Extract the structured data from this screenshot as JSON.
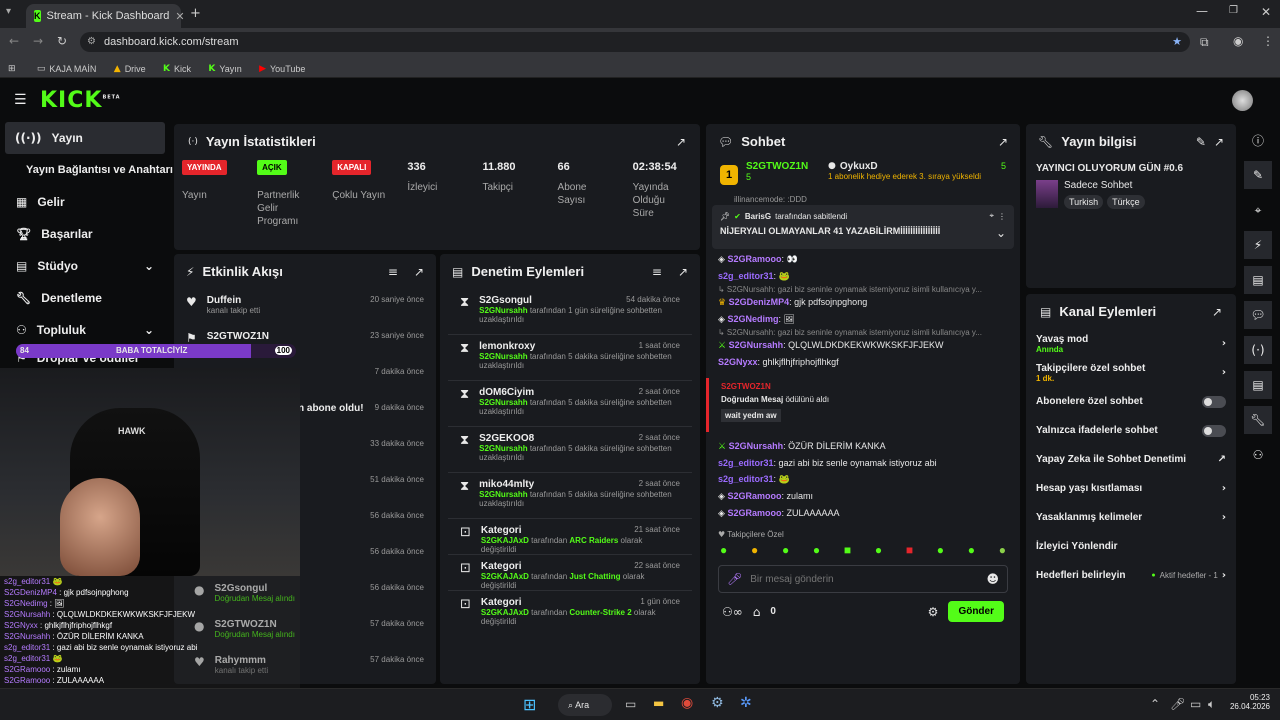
{
  "browser": {
    "tab_title": "Stream - Kick Dashboard",
    "url": "dashboard.kick.com/stream",
    "bookmarks": [
      {
        "label": "KAJA MAİN"
      },
      {
        "label": "Drive"
      },
      {
        "label": "Kick"
      },
      {
        "label": "Yayın"
      },
      {
        "label": "YouTube"
      }
    ]
  },
  "header": {
    "logo": "KICK",
    "logo_sup": "BETA"
  },
  "sidebar": {
    "items": [
      {
        "label": "Yayın"
      },
      {
        "label": "Yayın Bağlantısı ve Anahtarı"
      },
      {
        "label": "Gelir"
      },
      {
        "label": "Başarılar"
      },
      {
        "label": "Stüdyo"
      },
      {
        "label": "Denetleme"
      },
      {
        "label": "Topluluk"
      },
      {
        "label": "Droplar ve ödüller"
      }
    ]
  },
  "stats": {
    "title": "Yayın İstatistikleri",
    "items": [
      {
        "badge": "YAYINDA",
        "badge_color": "#e5252b",
        "label": "Yayın"
      },
      {
        "badge": "AÇIK",
        "badge_color": "#53fc18",
        "label": "Partnerlik Gelir Programı"
      },
      {
        "badge": "KAPALI",
        "badge_color": "#e5252b",
        "label": "Çoklu Yayın"
      },
      {
        "value": "336",
        "label": "İzleyici"
      },
      {
        "value": "11.880",
        "label": "Takipçi"
      },
      {
        "value": "66",
        "label": "Abone Sayısı"
      },
      {
        "value": "02:38:54",
        "label": "Yayında Olduğu Süre"
      }
    ]
  },
  "activity": {
    "title": "Etkinlik Akışı",
    "rows": [
      {
        "name": "Duffein",
        "sub": "kanalı takip etti",
        "time": "20 saniye önce"
      },
      {
        "name": "S2GTWOZ1N",
        "sub": "",
        "time": "23 saniye önce"
      },
      {
        "name": "",
        "sub": "",
        "time": "7 dakika önce"
      },
      {
        "name": "n abone oldu!",
        "sub": "",
        "time": "9 dakika önce"
      },
      {
        "name": "",
        "sub": "",
        "time": "33 dakika önce"
      },
      {
        "name": "",
        "sub": "",
        "time": "51 dakika önce"
      },
      {
        "name": "",
        "sub": "",
        "time": "56 dakika önce"
      },
      {
        "name": "",
        "sub": "",
        "time": "56 dakika önce"
      },
      {
        "name": "S2Gsongul",
        "sub": "Doğrudan Mesaj alındı",
        "time": "56 dakika önce"
      },
      {
        "name": "S2GTWOZ1N",
        "sub": "Doğrudan Mesaj alındı",
        "time": "57 dakika önce"
      },
      {
        "name": "Rahymmm",
        "sub": "kanalı takip etti",
        "time": "57 dakika önce"
      }
    ]
  },
  "moderation": {
    "title": "Denetim Eylemleri",
    "rows": [
      {
        "name": "S2Gsongul",
        "time": "54 dakika önce",
        "actor": "S2GNursahh",
        "text": " tarafından 1 gün süreliğine sohbetten uzaklaştırıldı",
        "icon": "hourglass"
      },
      {
        "name": "lemonkroxy",
        "time": "1 saat önce",
        "actor": "S2GNursahh",
        "text": " tarafından 5 dakika süreliğine sohbetten uzaklaştırıldı",
        "icon": "hourglass"
      },
      {
        "name": "dOM6Ciyim",
        "time": "2 saat önce",
        "actor": "S2GNursahh",
        "text": " tarafından 5 dakika süreliğine sohbetten uzaklaştırıldı",
        "icon": "hourglass"
      },
      {
        "name": "S2GEKOO8",
        "time": "2 saat önce",
        "actor": "S2GNursahh",
        "text": " tarafından 5 dakika süreliğine sohbetten uzaklaştırıldı",
        "icon": "hourglass"
      },
      {
        "name": "miko44mlty",
        "time": "2 saat önce",
        "actor": "S2GNursahh",
        "text": " tarafından 5 dakika süreliğine sohbetten uzaklaştırıldı",
        "icon": "hourglass"
      },
      {
        "name": "Kategori",
        "time": "21 saat önce",
        "actor": "S2GKAJAxD",
        "text": " tarafından ",
        "target": "ARC Raiders",
        "suffix": " olarak değiştirildi",
        "icon": "category"
      },
      {
        "name": "Kategori",
        "time": "22 saat önce",
        "actor": "S2GKAJAxD",
        "text": " tarafından ",
        "target": "Just Chatting",
        "suffix": " olarak değiştirildi",
        "icon": "category"
      },
      {
        "name": "Kategori",
        "time": "1 gün önce",
        "actor": "S2GKAJAxD",
        "text": " tarafından ",
        "target": "Counter-Strike 2",
        "suffix": " olarak değiştirildi",
        "icon": "category"
      }
    ]
  },
  "chat": {
    "title": "Sohbet",
    "top_gifter": {
      "name": "S2GTWOZ1N",
      "count": "5",
      "rank": "1"
    },
    "gift_user": {
      "name": "OykuxD",
      "count": "5",
      "text": "1 abonelik hediye ederek 3. sıraya yükseldi"
    },
    "partial_line": "illinancemode: :DDD",
    "pinned": {
      "by": "BarisG",
      "by_suffix": "tarafından sabitlendi",
      "text": "NİJERYALI OLMAYANLAR 41 YAZABİLİRMİİİİİİİİİİİİİİİİ"
    },
    "messages": [
      {
        "user": "S2GRamooo",
        "color": "#b57bff",
        "text": " 👀"
      },
      {
        "user": "s2g_editor31",
        "color": "#9b6bff",
        "text": " 🐸"
      },
      {
        "reply": "↳ S2GNursahh: gazi biz seninle oynamak istemiyoruz isimli kullanıcıya y..."
      },
      {
        "user": "S2GDenizMP4",
        "color": "#b57bff",
        "text": " gjk pdfsojnpghong"
      },
      {
        "user": "S2GNedimg",
        "color": "#b57bff",
        "text": " 🖼"
      },
      {
        "reply": "↳ S2GNursahh: gazi biz seninle oynamak istemiyoruz isimli kullanıcıya y..."
      },
      {
        "user": "S2GNursahh",
        "color": "#b57bff",
        "text": " QLQLWLDKDKEKWKWKSKFJFJEKW"
      },
      {
        "user": "S2GNyxx",
        "color": "#b57bff",
        "text": " ghlkjflhjfriphojflhkgf"
      }
    ],
    "gift_card": {
      "user": "S2GTWOZ1N",
      "line": "Doğrudan Mesaj",
      "line_suffix": " ödülünü aldı",
      "message": "wait yedm aw"
    },
    "messages2": [
      {
        "user": "S2GNursahh",
        "color": "#b57bff",
        "text": " ÖZÜR DİLERİM KANKA"
      },
      {
        "user": "s2g_editor31",
        "color": "#9b6bff",
        "text": " gazi abi biz senle oynamak istiyoruz abi"
      },
      {
        "user": "s2g_editor31",
        "color": "#9b6bff",
        "text": " 🐸"
      },
      {
        "user": "S2GRamooo",
        "color": "#b57bff",
        "text": " zulamı"
      },
      {
        "user": "S2GRamooo",
        "color": "#b57bff",
        "text": " ZULAAAAAA"
      }
    ],
    "followers_only": "Takipçilere Özel",
    "input_placeholder": "Bir mesaj gönderin",
    "points": "0",
    "send": "Gönder"
  },
  "stream_info": {
    "title": "Yayın bilgisi",
    "stream_title": "YAYINCI OLUYORUM GÜN #0.6",
    "category": "Sadece Sohbet",
    "tags": [
      "Turkish",
      "Türkçe"
    ]
  },
  "channel_actions": {
    "title": "Kanal Eylemleri",
    "rows": [
      {
        "label": "Yavaş mod",
        "sub": "Anında",
        "type": "chevron"
      },
      {
        "label": "Takipçilere özel sohbet",
        "sub": "1 dk.",
        "type": "chevron"
      },
      {
        "label": "Abonelere özel sohbet",
        "type": "toggle"
      },
      {
        "label": "Yalnızca ifadelerle sohbet",
        "type": "toggle"
      },
      {
        "label": "Yapay Zeka ile Sohbet Denetimi",
        "type": "external"
      },
      {
        "label": "Hesap yaşı kısıtlaması",
        "type": "chevron"
      },
      {
        "label": "Yasaklanmış kelimeler",
        "type": "chevron"
      },
      {
        "label": "İzleyici Yönlendir",
        "type": "none"
      },
      {
        "label": "Hedefleri belirleyin",
        "status": "Aktif hedefler - 1",
        "type": "chevron"
      }
    ]
  },
  "overlay": {
    "goal_bar": {
      "left": "84",
      "text": "BABA TOTALCİYİZ",
      "right": "100",
      "progress": 0.84
    },
    "chat": [
      {
        "user": "s2g_editor31",
        "text": " 🐸"
      },
      {
        "user": "S2GDenizMP4",
        "text": " : gjk pdfsojnpghong"
      },
      {
        "user": "S2GNedimg",
        "text": " : 🖼"
      },
      {
        "user": "S2GNursahh",
        "text": " : QLQLWLDKDKEKWKWKSKFJFJEKW"
      },
      {
        "user": "S2GNyxx",
        "text": " : ghlkjflhjfriphojflhkgf"
      },
      {
        "user": "S2GNursahh",
        "text": " : ÖZÜR DİLERİM KANKA"
      },
      {
        "user": "s2g_editor31",
        "text": " : gazi abi biz senle oynamak istiyoruz abi"
      },
      {
        "user": "s2g_editor31",
        "text": " 🐸"
      },
      {
        "user": "S2GRamooo",
        "text": " : zulamı"
      },
      {
        "user": "S2GRamooo",
        "text": " : ZULAAAAAA"
      }
    ],
    "chair_brand": "HAWK"
  },
  "taskbar": {
    "search": "Ara",
    "time": "05:23",
    "date": "26.04.2026"
  }
}
